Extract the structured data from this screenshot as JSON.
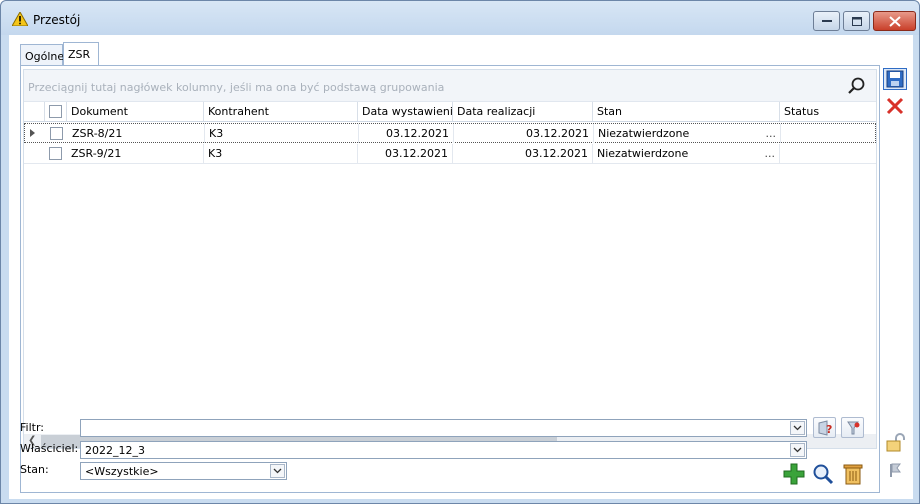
{
  "window": {
    "title": "Przestój"
  },
  "tabs": [
    {
      "label": "Ogólne"
    },
    {
      "label": "ZSR"
    }
  ],
  "grid": {
    "group_hint": "Przeciągnij tutaj nagłówek kolumny, jeśli ma ona być podstawą grupowania",
    "columns": [
      {
        "label": "Dokument"
      },
      {
        "label": "Kontrahent"
      },
      {
        "label": "Data wystawienia"
      },
      {
        "label": "Data realizacji"
      },
      {
        "label": "Stan"
      },
      {
        "label": "Status"
      }
    ],
    "rows": [
      {
        "dokument": "ZSR-8/21",
        "kontrahent": "K3",
        "data_wystawienia": "03.12.2021",
        "data_realizacji": "03.12.2021",
        "stan": "Niezatwierdzone",
        "ellipsis": "..."
      },
      {
        "dokument": "ZSR-9/21",
        "kontrahent": "K3",
        "data_wystawienia": "03.12.2021",
        "data_realizacji": "03.12.2021",
        "stan": "Niezatwierdzone",
        "ellipsis": "..."
      }
    ]
  },
  "filters": {
    "filtr_label": "Filtr:",
    "filtr_value": "",
    "wlasciciel_label": "Właściciel:",
    "wlasciciel_value": "2022_12_3",
    "stan_label": "Stan:",
    "stan_value": "<Wszystkie>"
  },
  "icons": {
    "save": "save-icon",
    "cancel": "close-icon",
    "add": "plus-icon",
    "preview": "magnifier-icon",
    "delete": "trash-icon"
  },
  "colors": {
    "add": "#3aa33a",
    "cancel": "#d8322a",
    "save": "#2f6cc4"
  }
}
